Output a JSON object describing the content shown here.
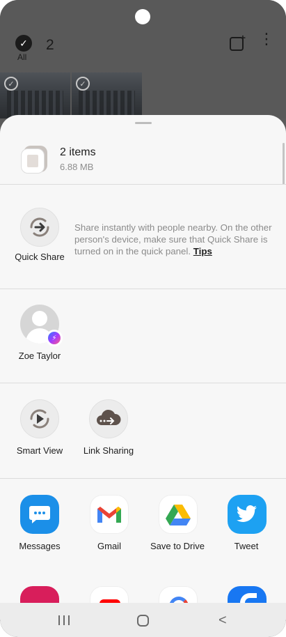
{
  "gallery": {
    "select_all_label": "All",
    "selected_count": "2"
  },
  "share": {
    "items_title": "2 items",
    "items_size": "6.88 MB",
    "quick_share": {
      "label": "Quick Share",
      "description": "Share instantly with people nearby. On the other person's device, make sure that Quick Share is turned on in the quick panel.",
      "tips_link": "Tips"
    },
    "contact": {
      "name": "Zoe Taylor"
    },
    "actions": [
      {
        "label": "Smart View"
      },
      {
        "label": "Link Sharing"
      }
    ],
    "apps": [
      {
        "label": "Messages",
        "color": "#1b8fe8"
      },
      {
        "label": "Gmail",
        "color": "#ffffff"
      },
      {
        "label": "Save to Drive",
        "color": "#ffffff"
      },
      {
        "label": "Tweet",
        "color": "#1da1f2"
      }
    ]
  },
  "navbar": {
    "back_glyph": "<"
  }
}
